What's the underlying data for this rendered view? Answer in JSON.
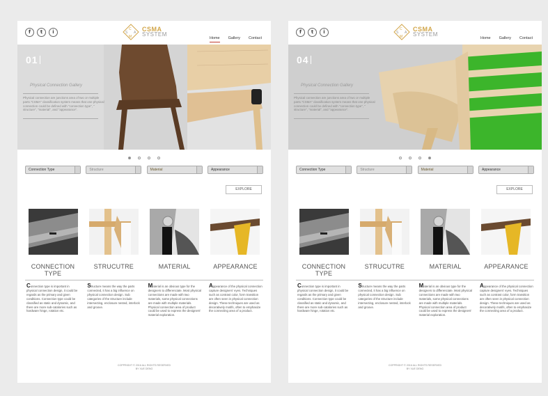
{
  "header": {
    "social": [
      "f",
      "t",
      "i"
    ],
    "logo_letters": "CSMA",
    "logo_subtitle": "SYSTEM",
    "nav": [
      "Home",
      "Gallery",
      "Contact"
    ]
  },
  "hero": {
    "title": "Physical Connection Gallery",
    "description": "Physical connection are junctions area of two or multiple parts.\"CSMA\" classification system means that one physical connection could be defined with \"connection type\", \" structure\", \"material\", and \"appearance\"."
  },
  "filters": [
    "Connection Type",
    "Structure",
    "Material",
    "Appearance"
  ],
  "explore_label": "EXPLORE",
  "cards": [
    {
      "title": "CONNECTION TYPE",
      "cap": "C",
      "body": "onnection type is important in physical connection design, it could be regards as the primary and given conditions. Connection type could be classified as static and dynamic, and there are more sub-catalories such as hardware hinge, rotation etc."
    },
    {
      "title": "STRUCUTRE",
      "cap": "S",
      "body": "tructure means the way the parts connected, it has a big influence on physical connection design. Sub categories of the structure include intersecting, enclosure nested, interlock and groove."
    },
    {
      "title": "MATERIAL",
      "cap": "M",
      "body": "aterial is an obvious type for the designers to differenciate. Most physical connections are made with two materials, some physical connections are made with multiple materials. Physical connection area of product could be used to express the designers' material exploration."
    },
    {
      "title": "APPEARANCE",
      "cap": "A",
      "body": "ppearance of the physical connection capture designers' eyes. Techniques such as contrast color, form transition are often seen in physical connection design. These techniques are used as decoratively motifs, often to emphasize the connecting area of a product."
    }
  ],
  "footer": {
    "line1": "COPPRIGHT © 2016 ALL RIGHTS RESERVED",
    "line2": "BY XUE DENG"
  },
  "pages": [
    {
      "slide_number": "01",
      "active_dot": 0
    },
    {
      "slide_number": "04",
      "active_dot": 3
    }
  ],
  "colors": {
    "accent_gold": "#d2a64a",
    "nav_underline": "#c0392b",
    "chair_green": "#3cb52b",
    "leg_yellow": "#e6b726"
  }
}
